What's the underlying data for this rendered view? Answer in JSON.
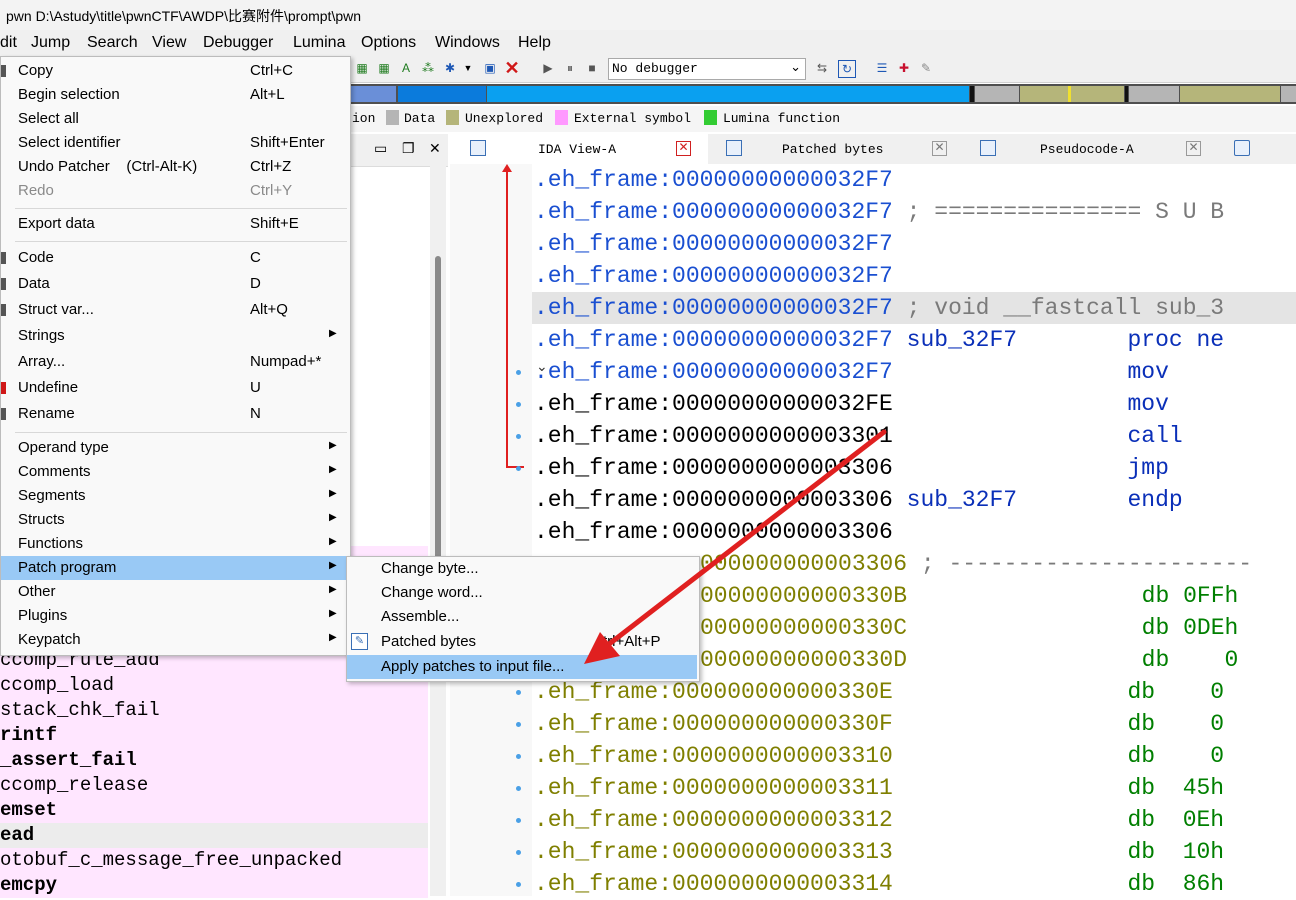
{
  "window": {
    "title": "pwn D:\\Astudy\\title\\pwnCTF\\AWDP\\比赛附件\\prompt\\pwn"
  },
  "menubar": [
    "dit",
    "Jump",
    "Search",
    "View",
    "Debugger",
    "Lumina",
    "Options",
    "Windows",
    "Help"
  ],
  "toolbar": {
    "debugger": "No debugger"
  },
  "legend": [
    {
      "label": "ion",
      "color": ""
    },
    {
      "label": "Data",
      "color": "#b5b5b5"
    },
    {
      "label": "Unexplored",
      "color": "#b5b57a"
    },
    {
      "label": "External symbol",
      "color": "#ff99ff"
    },
    {
      "label": "Lumina function",
      "color": "#33cc33"
    }
  ],
  "tabs": [
    {
      "label": "IDA View-A"
    },
    {
      "label": "Patched bytes"
    },
    {
      "label": "Pseudocode-A"
    }
  ],
  "context_menu": {
    "items": [
      {
        "label": "Copy",
        "shortcut": "Ctrl+C"
      },
      {
        "label": "Begin selection",
        "shortcut": "Alt+L"
      },
      {
        "label": "Select all",
        "shortcut": ""
      },
      {
        "label": "Select identifier",
        "shortcut": "Shift+Enter"
      },
      {
        "label": "Undo Patcher    (Ctrl-Alt-K)",
        "shortcut": "Ctrl+Z"
      },
      {
        "label": "Redo",
        "shortcut": "Ctrl+Y"
      },
      {
        "label": "Export data",
        "shortcut": "Shift+E"
      },
      {
        "label": "Code",
        "shortcut": "C"
      },
      {
        "label": "Data",
        "shortcut": "D"
      },
      {
        "label": "Struct var...",
        "shortcut": "Alt+Q"
      },
      {
        "label": "Strings",
        "shortcut": ""
      },
      {
        "label": "Array...",
        "shortcut": "Numpad+*"
      },
      {
        "label": "Undefine",
        "shortcut": "U"
      },
      {
        "label": "Rename",
        "shortcut": "N"
      },
      {
        "label": "Operand type",
        "shortcut": ""
      },
      {
        "label": "Comments",
        "shortcut": ""
      },
      {
        "label": "Segments",
        "shortcut": ""
      },
      {
        "label": "Structs",
        "shortcut": ""
      },
      {
        "label": "Functions",
        "shortcut": ""
      },
      {
        "label": "Patch program",
        "shortcut": ""
      },
      {
        "label": "Other",
        "shortcut": ""
      },
      {
        "label": "Plugins",
        "shortcut": ""
      },
      {
        "label": "Keypatch",
        "shortcut": ""
      }
    ]
  },
  "patch_submenu": {
    "items": [
      {
        "label": "Change byte...",
        "shortcut": ""
      },
      {
        "label": "Change word...",
        "shortcut": ""
      },
      {
        "label": "Assemble...",
        "shortcut": ""
      },
      {
        "label": "Patched bytes",
        "shortcut": "trl+Alt+P"
      },
      {
        "label": "Apply patches to input file...",
        "shortcut": ""
      }
    ]
  },
  "functions": [
    "ccomp_rule_add",
    "ccomp_load",
    "stack_chk_fail",
    "rintf",
    "_assert_fail",
    "ccomp_release",
    "emset",
    "ead",
    "otobuf_c_message_free_unpacked",
    "emcpy"
  ],
  "disasm": [
    {
      "addr": ".eh_frame:00000000000032F7",
      "rest": ""
    },
    {
      "addr": ".eh_frame:00000000000032F7",
      "rest": " ; =============== S U B"
    },
    {
      "addr": ".eh_frame:00000000000032F7",
      "rest": ""
    },
    {
      "addr": ".eh_frame:00000000000032F7",
      "rest": ""
    },
    {
      "addr": ".eh_frame:00000000000032F7",
      "rest": " ; void __fastcall sub_3"
    },
    {
      "addr": ".eh_frame:00000000000032F7",
      "rest": " sub_32F7        proc ne"
    },
    {
      "addr": ".eh_frame:00000000000032F7",
      "rest": "                 mov"
    },
    {
      "addr": ".eh_frame:00000000000032FE",
      "rest": "                 mov"
    },
    {
      "addr": ".eh_frame:0000000000003301",
      "rest": "                 call"
    },
    {
      "addr": ".eh_frame:0000000000003306",
      "rest": "                 jmp"
    },
    {
      "addr": ".eh_frame:0000000000003306",
      "rest": " sub_32F7        endp"
    },
    {
      "addr": ".eh_frame:0000000000003306",
      "rest": ""
    },
    {
      "addr": "000000000003306",
      "rest": " ; ----------------------"
    },
    {
      "addr": "00000000000330B",
      "rest": "                 db 0FFh"
    },
    {
      "addr": "00000000000330C",
      "rest": "                 db 0DEh"
    },
    {
      "addr": "00000000000330D",
      "rest": "                 db    0"
    },
    {
      "addr": ".eh_frame:000000000000330E",
      "rest": "                 db    0"
    },
    {
      "addr": ".eh_frame:000000000000330F",
      "rest": "                 db    0"
    },
    {
      "addr": ".eh_frame:0000000000003310",
      "rest": "                 db    0"
    },
    {
      "addr": ".eh_frame:0000000000003311",
      "rest": "                 db  45h"
    },
    {
      "addr": ".eh_frame:0000000000003312",
      "rest": "                 db  0Eh"
    },
    {
      "addr": ".eh_frame:0000000000003313",
      "rest": "                 db  10h"
    },
    {
      "addr": ".eh_frame:0000000000003314",
      "rest": "                 db  86h"
    }
  ],
  "colors": {
    "code_addr": "#1a4fd1",
    "data_addr": "#7f7f00",
    "plain": "#000000",
    "comment": "#7a7a7a",
    "db_value": "#007f00",
    "menu_highlight": "#99c9f5",
    "arrow": "#e02020"
  }
}
